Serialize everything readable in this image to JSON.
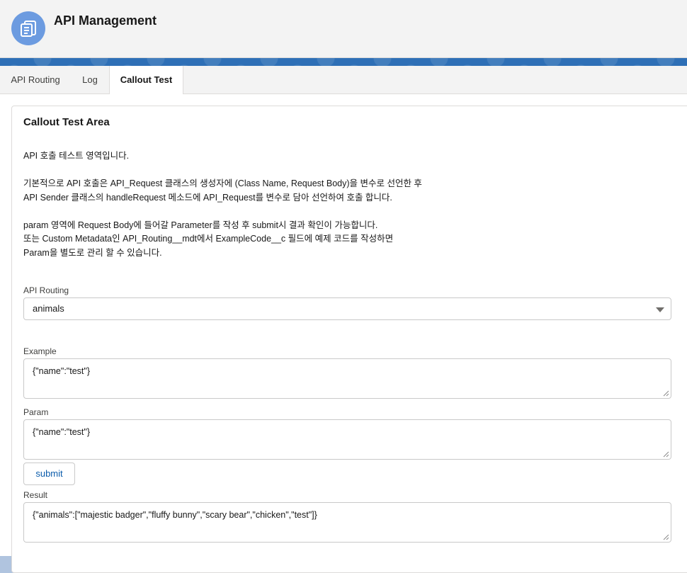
{
  "header": {
    "title": "API Management",
    "icon": "stacked-documents-icon",
    "icon_color": "#6c9be0"
  },
  "tabs": [
    {
      "label": "API Routing",
      "active": false
    },
    {
      "label": "Log",
      "active": false
    },
    {
      "label": "Callout Test",
      "active": true
    }
  ],
  "card": {
    "title": "Callout Test Area",
    "description": {
      "line1": "API 호출 테스트 영역입니다.",
      "line2": "기본적으로 API 호출은 API_Request 클래스의 생성자에 (Class Name, Request Body)을 변수로 선언한 후",
      "line3": "API Sender 클래스의 handleRequest 메소드에 API_Request를 변수로 담아 선언하여 호출 합니다.",
      "line4": "param 영역에 Request Body에 들어갈 Parameter를 작성 후 submit시 결과 확인이 가능합니다.",
      "line5": "또는 Custom Metadata인 API_Routing__mdt에서 ExampleCode__c 필드에 예제 코드를 작성하면",
      "line6": "Param을 별도로 관리 할 수 있습니다."
    }
  },
  "form": {
    "routing_label": "API Routing",
    "routing_value": "animals",
    "example_label": "Example",
    "example_value": "{\"name\":\"test\"}",
    "param_label": "Param",
    "param_value": "{\"name\":\"test\"}",
    "submit_label": "submit",
    "result_label": "Result",
    "result_value": "{\"animals\":[\"majestic badger\",\"fluffy bunny\",\"scary bear\",\"chicken\",\"test\"]}"
  },
  "colors": {
    "banner": "#2e6fb6",
    "link": "#0b5cab"
  }
}
